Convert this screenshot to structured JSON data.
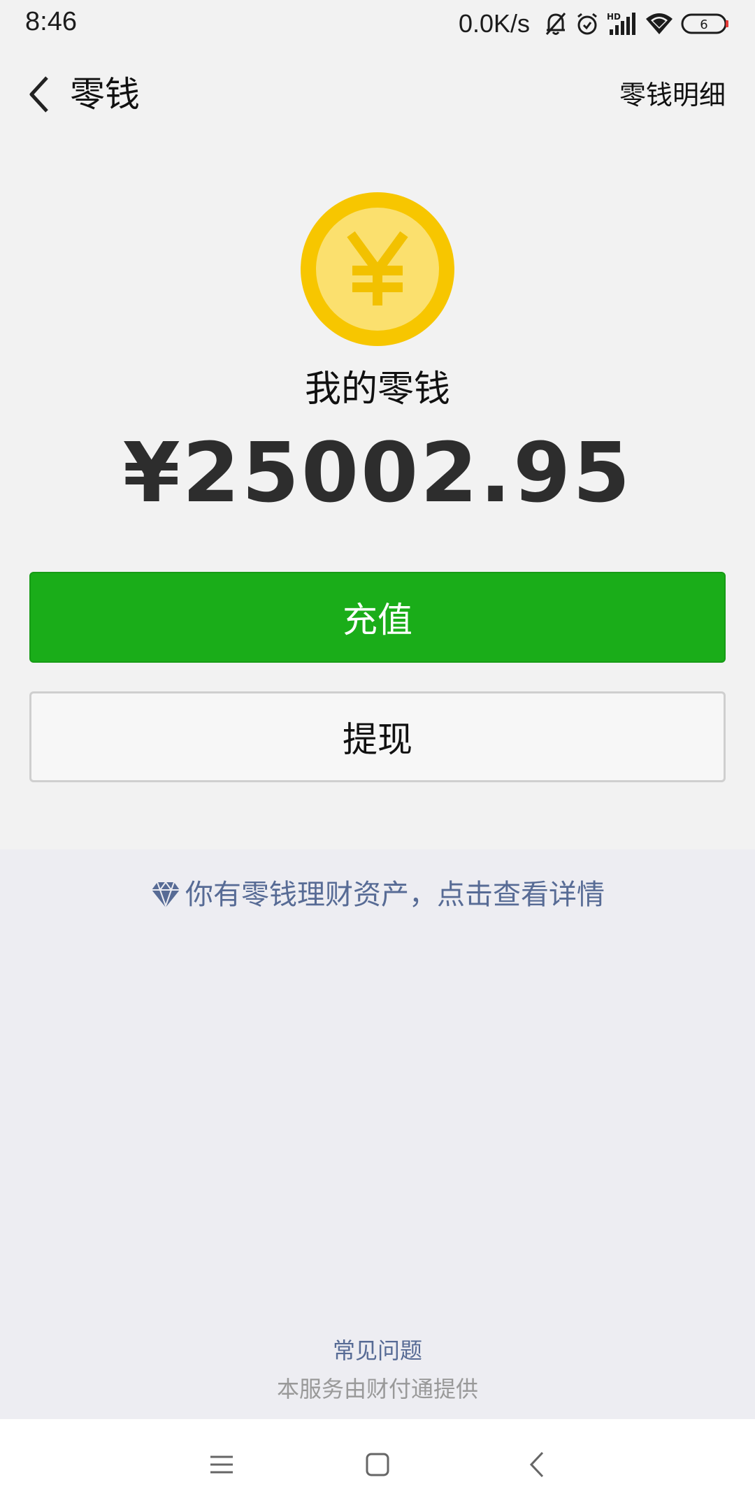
{
  "status_bar": {
    "time": "8:46",
    "speed": "0.0K/s",
    "battery": "6",
    "icons": [
      "mute-bell-icon",
      "alarm-icon",
      "hd-signal-icon",
      "wifi-icon",
      "battery-icon"
    ]
  },
  "nav": {
    "back_icon": "chevron-left-icon",
    "title": "零钱",
    "detail_link": "零钱明细"
  },
  "balance": {
    "coin_icon": "yuan-coin-icon",
    "label": "我的零钱",
    "amount": "¥25002.95"
  },
  "actions": {
    "topup_label": "充值",
    "withdraw_label": "提现"
  },
  "wealth": {
    "icon": "diamond-icon",
    "text": "你有零钱理财资产，点击查看详情"
  },
  "footer": {
    "faq": "常见问题",
    "provider": "本服务由财付通提供"
  },
  "system_nav": {
    "icons": [
      "menu-icon",
      "home-icon",
      "back-icon"
    ]
  },
  "colors": {
    "accent_green": "#1aad19",
    "link_blue": "#576b95",
    "coin_outer": "#f7c600",
    "coin_inner": "#fbe06e"
  }
}
